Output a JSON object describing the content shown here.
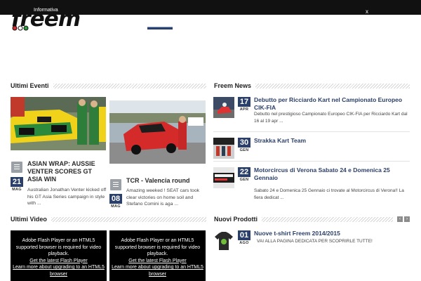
{
  "infobar": {
    "label": "Informativa",
    "close": "x"
  },
  "logo": {
    "text": "freem"
  },
  "sections": {
    "events": "Ultimi Eventi",
    "news": "Freem News",
    "videos": "Ultimi Video",
    "products": "Nuovi Prodotti"
  },
  "events": [
    {
      "title": "ASIAN WRAP: AUSSIE VENTER SCORES GT ASIA WIN",
      "day": "21",
      "month": "MAG",
      "excerpt": "Australian Jonathan Venter kicked off his GT Asia Series campaign in style with ..."
    },
    {
      "title": "TCR - Valencia round",
      "day": "08",
      "month": "MAG",
      "excerpt": "Amazing weeked ! SEAT cars took clear victories on home soil and Stefano Comini is aga ..."
    }
  ],
  "news": [
    {
      "title": "Debutto per Ricciardo Kart nel Campionato Europeo CIK-FIA",
      "day": "17",
      "month": "APR",
      "excerpt": "Debutto nel prestigioso Campionato Europeo CIK-FIA per Ricciardo Kart dal 16 al 19 apr ..."
    },
    {
      "title": "Strakka Kart Team",
      "day": "30",
      "month": "GEN",
      "excerpt": ""
    },
    {
      "title": "Motorcircus di Verona Sabato 24 e Domenica 25 Gennaio",
      "day": "22",
      "month": "GEN",
      "excerpt": "Sabato 24 e Domenica 25 Gennaio ci trovate al Motorcircus di Verona!! La fiera dedicat ..."
    }
  ],
  "video": {
    "line1": "Adobe Flash Player or an HTML5 supported browser is required for video playback.",
    "link1": "Get the latest Flash Player",
    "link2": "Learn more about upgrading to an HTML5 browser"
  },
  "product": {
    "title": "Nuove t-shirt Freem 2014/2015",
    "day": "01",
    "month": "AGO",
    "excerpt": "VAI ALLA PAGINA DEDICATA PER SCOPRIRLE TUTTE!"
  },
  "colors": {
    "accent": "#2a3f69",
    "infobar": "#111111"
  }
}
